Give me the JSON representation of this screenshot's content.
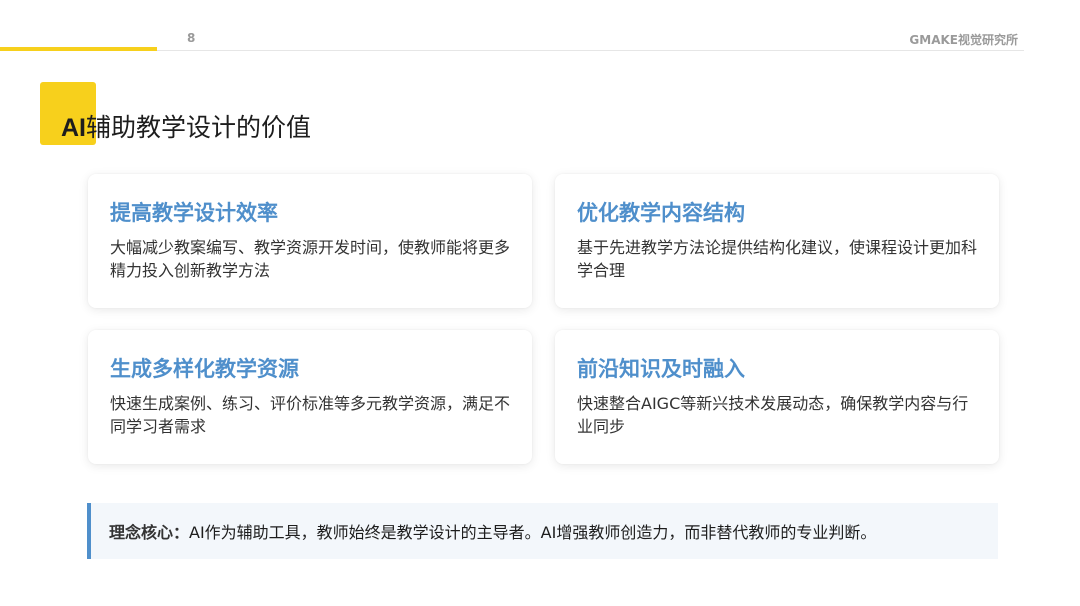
{
  "header": {
    "page_number": "8",
    "brand": "GMAKE视觉研究所"
  },
  "title": {
    "prefix": "AI",
    "text": "辅助教学设计的价值"
  },
  "cards": [
    {
      "heading": "提高教学设计效率",
      "body": "大幅减少教案编写、教学资源开发时间，使教师能将更多精力投入创新教学方法"
    },
    {
      "heading": "优化教学内容结构",
      "body": "基于先进教学方法论提供结构化建议，使课程设计更加科学合理"
    },
    {
      "heading": "生成多样化教学资源",
      "body": "快速生成案例、练习、评价标准等多元教学资源，满足不同学习者需求"
    },
    {
      "heading": "前沿知识及时融入",
      "body": "快速整合AIGC等新兴技术发展动态，确保教学内容与行业同步"
    }
  ],
  "core": {
    "label": "理念核心：",
    "text": "AI作为辅助工具，教师始终是教学设计的主导者。AI增强教师创造力，而非替代教师的专业判断。"
  },
  "colors": {
    "accent_yellow": "#f7d01c",
    "heading_blue": "#4f8fcb"
  }
}
